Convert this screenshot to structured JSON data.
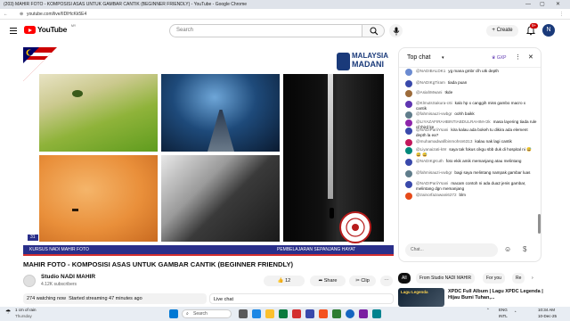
{
  "window": {
    "title": "(203) MAHIR FOTO - KOMPOSISI ASAS UNTUK GAMBAR CANTIK (BEGINNER FRIENDLY) - YouTube - Google Chrome",
    "url": "youtube.com/live/IIDlHcKk5E4"
  },
  "header": {
    "logo_text": "YouTube",
    "logo_superscript": "MY",
    "search_placeholder": "Search",
    "create_label": "Create",
    "notif_count": "9+",
    "avatar_letter": "N"
  },
  "player": {
    "badge_line1": "MALAYSIA",
    "badge_line2": "MADANI",
    "slide_number": "31",
    "caption_left": "KURSUS NADI MAHIR FOTO",
    "caption_right": "PEMBELAJARAN SEPANJANG HAYAT",
    "seal_text": "PERBADANAN KOMUNITI NADI MAHIR"
  },
  "video": {
    "title": "MAHIR FOTO - KOMPOSISI ASAS UNTUK GAMBAR CANTIK (BEGINNER FRIENDLY)",
    "channel": "Studio NADI MAHIR",
    "subscribers": "4.12K subscribers",
    "likes": "12",
    "share_label": "Share",
    "clip_label": "Clip",
    "watching": "274 watching now",
    "started": "Started streaming 47 minutes ago"
  },
  "chat": {
    "header": "Top chat",
    "badge": "GXP",
    "input_placeholder": "Chat...",
    "live_label": "Live chat",
    "messages": [
      {
        "name": "@NADIBALDK1",
        "text": "yg mana gmbr clh utk depth",
        "color": "#6b8bd1"
      },
      {
        "name": "@NADIKgTiram",
        "text": "tiada puan",
        "color": "#3949ab"
      },
      {
        "name": "@AsiahMwani",
        "text": "tkde",
        "color": "#9c6b3a"
      },
      {
        "name": "@KlmutsSakura-c6i",
        "text": "kalo hp x canggih miss gambo macro x cantik",
        "color": "#5e35b1"
      },
      {
        "name": "@fahmisauzi-vwbgr",
        "text": "oohh baikk",
        "color": "#607d8b"
      },
      {
        "name": "@LIYAZAFIRAHBINTIABDULRAHIM-r2k",
        "text": "masa layering tiada rule of third ke",
        "color": "#8e24aa"
      },
      {
        "name": "@NADIPariiYsani",
        "text": "kira kalau ada bokeh tu dikira ada element depth la ea?",
        "color": "#3949ab"
      },
      {
        "name": "@muhamadwafibinmohsn6313",
        "text": "kalau nak lagi cantik",
        "color": "#c2185b"
      },
      {
        "name": "@Liyanaizati-k9r",
        "text": "saya tak fokus cikgu sbb duk di hospital ni 😅 😅 😅",
        "color": "#00897b"
      },
      {
        "name": "@NADIKgKuth",
        "text": "foto ekik amik memanjang atau melintang",
        "color": "#3949ab"
      },
      {
        "name": "@fahmisauzi-vwbgr",
        "text": "bagi saya melintang nampak gambar luas",
        "color": "#607d8b"
      },
      {
        "name": "@NADIPariiYsani",
        "text": "macam contoh ni ada dua2 jenis gambar, melintang dgn memanjang",
        "color": "#3949ab"
      },
      {
        "name": "@zainorfazawani6272",
        "text": "blm",
        "color": "#e64a19"
      }
    ]
  },
  "related": {
    "chips": [
      "All",
      "From Studio NADI MAHIR",
      "For you",
      "Re"
    ],
    "card_title": "XPDC Full Album | Lagu XPDC Legenda | Hijau Bumi Tuhan,...",
    "card_thumb_text": "Lagu Legenda"
  },
  "taskbar": {
    "weather": "1 cm of rain",
    "day": "Thursday",
    "search_label": "Search",
    "lang": "ENG",
    "region": "INTL",
    "time": "10:34 AM",
    "date": "10-Dec-25"
  }
}
